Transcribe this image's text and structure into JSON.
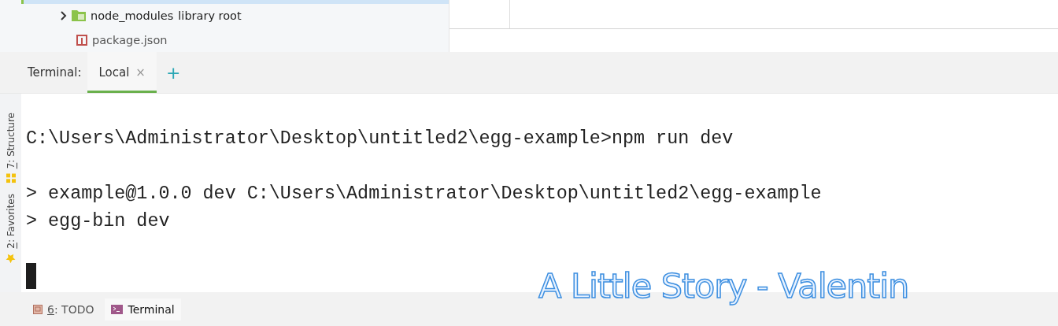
{
  "project_tree": {
    "items": [
      {
        "kind": "folder",
        "name": "node_modules",
        "note": "library root",
        "expanded": false
      },
      {
        "kind": "file",
        "name": "package.json"
      }
    ]
  },
  "terminal": {
    "label": "Terminal:",
    "tabs": [
      {
        "label": "Local",
        "close": "×",
        "selected": true
      }
    ],
    "new_tab": "+",
    "lines": [
      {
        "text": "C:\\Users\\Administrator\\Desktop\\untitled2\\egg-example>npm run dev",
        "blank_before": false
      },
      {
        "text": "> example@1.0.0 dev C:\\Users\\Administrator\\Desktop\\untitled2\\egg-example",
        "blank_before": true
      },
      {
        "text": "> egg-bin dev",
        "blank_before": false
      }
    ],
    "cursor": true
  },
  "left_tool_windows": [
    {
      "kind": "structure",
      "number": "7",
      "label": ": Structure"
    },
    {
      "kind": "favorites",
      "number": "2",
      "label": ": Favorites"
    }
  ],
  "bottom_tool_windows": [
    {
      "kind": "todo",
      "number": "6",
      "label": ": TODO",
      "selected": false
    },
    {
      "kind": "terminal",
      "label": "Terminal",
      "selected": true
    }
  ],
  "desktop_lyrics": "A Little Story - Valentin"
}
